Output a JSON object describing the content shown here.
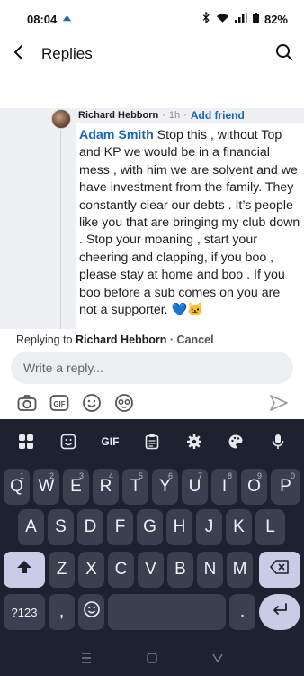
{
  "status_bar": {
    "time": "08:04",
    "battery": "82%"
  },
  "header": {
    "title": "Replies"
  },
  "reply": {
    "author": "Richard Hebborn",
    "time": "1h",
    "add_friend": "Add friend",
    "mention": "Adam Smith",
    "body": " Stop this , without Top and KP we would be in a financial mess , with him we are solvent and we have investment from the family. They constantly clear our debts . It’s people like you that are bringing my club down . Stop your moaning , start your cheering and clapping, if you boo , please stay at home and boo . If you boo before a sub comes on  you are not a supporter. 💙🐱",
    "emoji_tail": "💙🐱"
  },
  "composer": {
    "replying_to_label": "Replying to",
    "replying_to_name": "Richard Hebborn",
    "cancel": "· Cancel",
    "placeholder": "Write a reply..."
  },
  "keyboard": {
    "toolbar": {
      "gif": "GIF"
    },
    "row1": [
      "Q",
      "W",
      "E",
      "R",
      "T",
      "Y",
      "U",
      "I",
      "O",
      "P"
    ],
    "row1_nums": [
      "1",
      "2",
      "3",
      "4",
      "5",
      "6",
      "7",
      "8",
      "9",
      "0"
    ],
    "row2": [
      "A",
      "S",
      "D",
      "F",
      "G",
      "H",
      "J",
      "K",
      "L"
    ],
    "row3": [
      "Z",
      "X",
      "C",
      "V",
      "B",
      "N",
      "M"
    ],
    "symbols_key": "?123",
    "comma": ",",
    "period": "."
  },
  "icons": {
    "back": "arrow-left-icon",
    "search": "search-icon",
    "camera": "camera-icon",
    "gif": "gif-icon",
    "emoji": "emoji-icon",
    "avatar_sticker": "avatar-sticker-icon",
    "send": "send-icon"
  },
  "colors": {
    "accent": "#1565c0",
    "keyboard_bg": "#1e2230",
    "key_bg": "#3b3f4f"
  }
}
